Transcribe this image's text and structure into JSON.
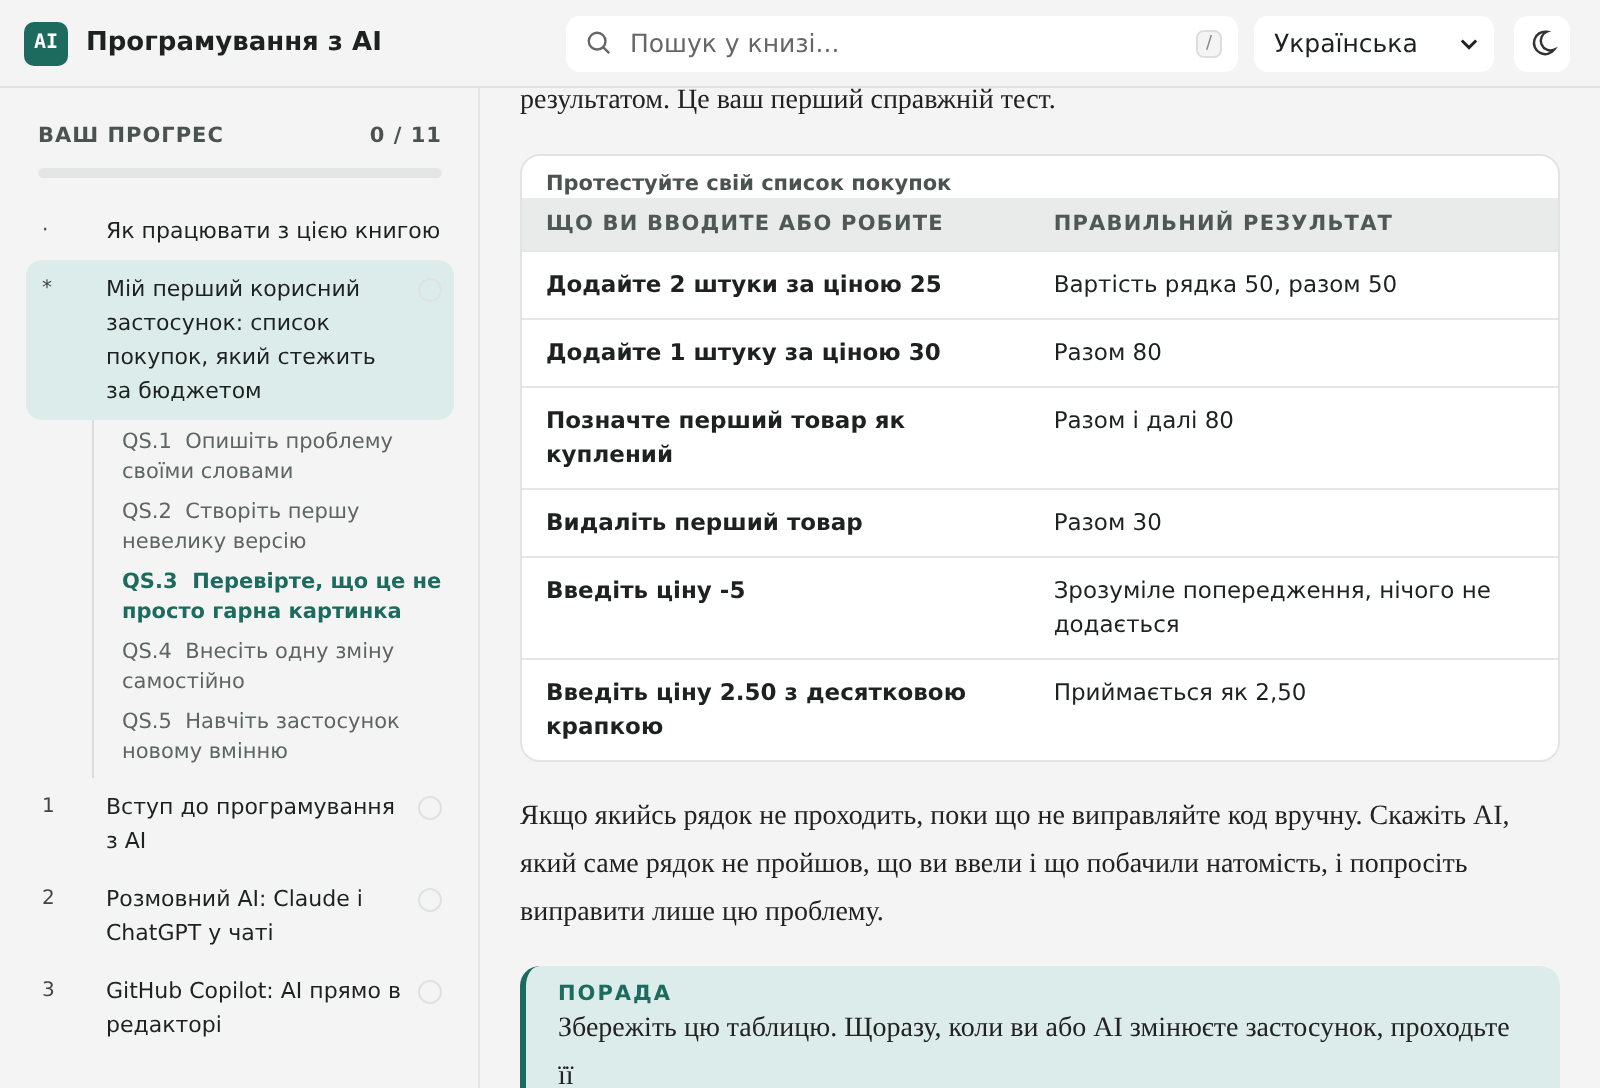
{
  "header": {
    "logo": "AI",
    "title": "Програмування з AI",
    "search": {
      "placeholder": "Пошук у книзі...",
      "shortcut": "/"
    },
    "language": "Українська"
  },
  "sidebar": {
    "progress": {
      "label": "ВАШ ПРОГРЕС",
      "count": "0 / 11",
      "level": 0
    },
    "items": [
      {
        "kind": "page",
        "marker": "·",
        "title": "Як працювати з цією книгою",
        "selected": false
      },
      {
        "kind": "chapter",
        "marker": "*",
        "title": "Мій перший корисний застосунок: список покупок, який стежить за бюджетом",
        "selected": true,
        "done": false,
        "children": [
          {
            "number": "QS.1",
            "title": "Опишіть проблему своїми словами",
            "selected": false
          },
          {
            "number": "QS.2",
            "title": "Створіть першу невелику версію",
            "selected": false
          },
          {
            "number": "QS.3",
            "title": "Перевірте, що це не просто гарна картинка",
            "selected": true
          },
          {
            "number": "QS.4",
            "title": "Внесіть одну зміну самостійно",
            "selected": false
          },
          {
            "number": "QS.5",
            "title": "Навчіть застосунок новому вмінню",
            "selected": false
          }
        ]
      },
      {
        "kind": "chapter",
        "marker": "1",
        "title": "Вступ до програмування з AI",
        "selected": false,
        "done": false
      },
      {
        "kind": "chapter",
        "marker": "2",
        "title": "Розмовний AI: Claude і ChatGPT у чаті",
        "selected": false,
        "done": false
      },
      {
        "kind": "chapter",
        "marker": "3",
        "title": "GitHub Copilot: AI прямо в редакторі",
        "selected": false,
        "done": false
      }
    ]
  },
  "content": {
    "intro": "результатом. Це ваш перший справжній тест.",
    "table": {
      "caption": "Протестуйте свій список покупок",
      "columns": [
        "ЩО ВИ ВВОДИТЕ АБО РОБИТЕ",
        "ПРАВИЛЬНИЙ РЕЗУЛЬТАТ"
      ],
      "rows": [
        [
          "Додайте 2 штуки за ціною 25",
          "Вартість рядка 50, разом 50"
        ],
        [
          "Додайте 1 штуку за ціною 30",
          "Разом 80"
        ],
        [
          "Позначте перший товар як куплений",
          "Разом і далі 80"
        ],
        [
          "Видаліть перший товар",
          "Разом 30"
        ],
        [
          "Введіть ціну -5",
          "Зрозуміле попередження, нічого не додається"
        ],
        [
          "Введіть ціну 2.50 з десятковою крапкою",
          "Приймається як 2,50"
        ]
      ]
    },
    "paragraph": "Якщо якийсь рядок не проходить, поки що не виправляйте код вручну. Скажіть AI, який саме рядок не пройшов, що ви ввели і що побачили натомість, і попросіть виправити лише цю проблему.",
    "tip": {
      "label": "ПОРАДА",
      "text": "Збережіть цю таблицю. Щоразу, коли ви або AI змінюєте застосунок, проходьте її"
    }
  }
}
